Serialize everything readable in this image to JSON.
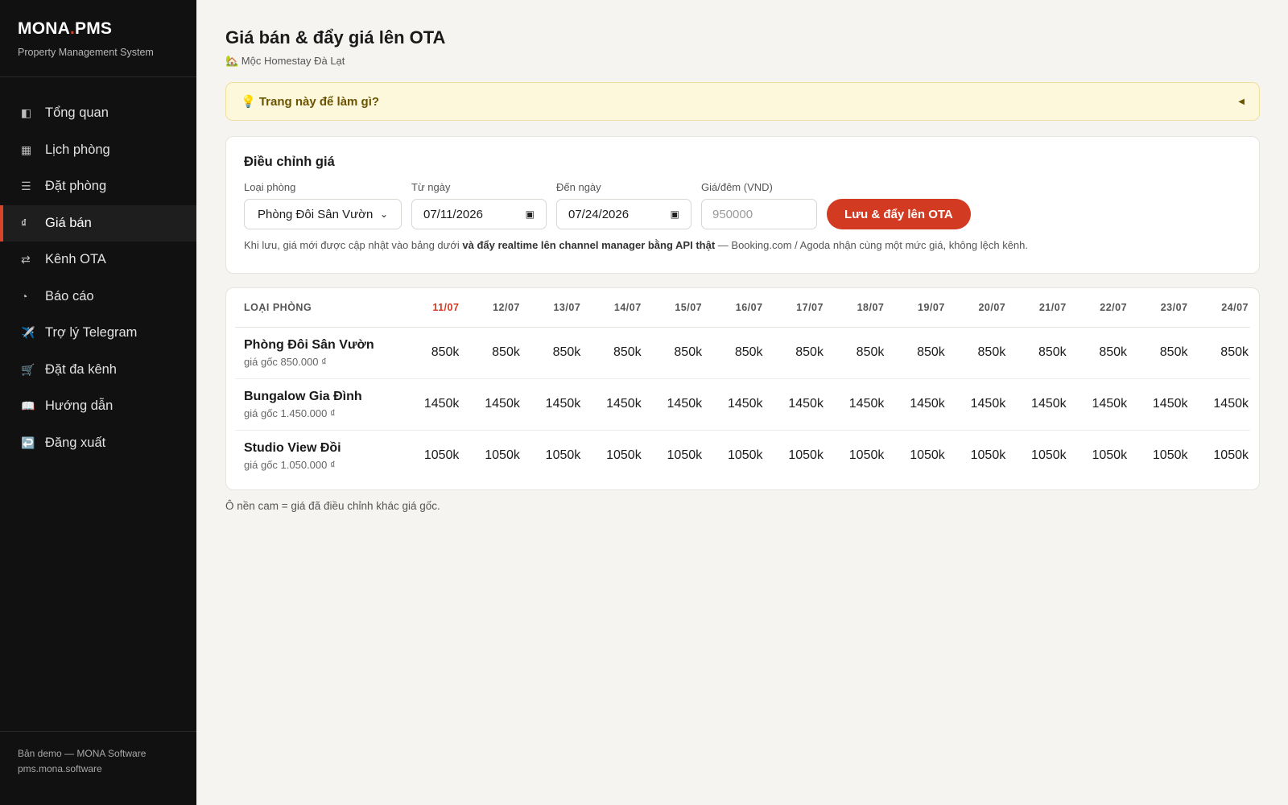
{
  "sidebar": {
    "brand_left": "MONA",
    "brand_dot": ".",
    "brand_right": "PMS",
    "subtitle": "Property Management System",
    "items": [
      {
        "icon": "◧",
        "label": "Tổng quan"
      },
      {
        "icon": "▦",
        "label": "Lịch phòng"
      },
      {
        "icon": "☰",
        "label": "Đặt phòng"
      },
      {
        "icon": "₫",
        "label": "Giá bán"
      },
      {
        "icon": "⇄",
        "label": "Kênh OTA"
      },
      {
        "icon": "◔",
        "label": "Báo cáo"
      },
      {
        "icon": "✈️",
        "label": "Trợ lý Telegram"
      },
      {
        "icon": "🛒",
        "label": "Đặt đa kênh"
      },
      {
        "icon": "📖",
        "label": "Hướng dẫn"
      },
      {
        "icon": "↩️",
        "label": "Đăng xuất"
      }
    ],
    "active_index": 3,
    "footer_line1": "Bản demo — MONA Software",
    "footer_line2": "pms.mona.software"
  },
  "header": {
    "title": "Giá bán & đẩy giá lên OTA",
    "property": "🏡 Mộc Homestay Đà Lạt"
  },
  "hint": {
    "label": "💡 Trang này để làm gì?",
    "caret": "◀"
  },
  "adjust": {
    "title": "Điều chỉnh giá",
    "room_type_label": "Loại phòng",
    "room_type_value": "Phòng Đôi Sân Vườn",
    "from_label": "Từ ngày",
    "from_value": "07/11/2026",
    "to_label": "Đến ngày",
    "to_value": "07/24/2026",
    "price_label": "Giá/đêm (VND)",
    "price_placeholder": "950000",
    "submit_label": "Lưu & đẩy lên OTA",
    "note_before": "Khi lưu, giá mới được cập nhật vào bảng dưới ",
    "note_bold": "và đẩy realtime lên channel manager bằng API thật",
    "note_after": " — Booking.com / Agoda nhận cùng một mức giá, không lệch kênh."
  },
  "table": {
    "room_header": "LOẠI PHÒNG",
    "dates": [
      "11/07",
      "12/07",
      "13/07",
      "14/07",
      "15/07",
      "16/07",
      "17/07",
      "18/07",
      "19/07",
      "20/07",
      "21/07",
      "22/07",
      "23/07",
      "24/07"
    ],
    "today_index": 0,
    "rows": [
      {
        "name": "Phòng Đôi Sân Vườn",
        "base": "giá gốc 850.000 ₫",
        "prices": [
          "850k",
          "850k",
          "850k",
          "850k",
          "850k",
          "850k",
          "850k",
          "850k",
          "850k",
          "850k",
          "850k",
          "850k",
          "850k",
          "850k"
        ]
      },
      {
        "name": "Bungalow Gia Đình",
        "base": "giá gốc 1.450.000 ₫",
        "prices": [
          "1450k",
          "1450k",
          "1450k",
          "1450k",
          "1450k",
          "1450k",
          "1450k",
          "1450k",
          "1450k",
          "1450k",
          "1450k",
          "1450k",
          "1450k",
          "1450k"
        ]
      },
      {
        "name": "Studio View Đồi",
        "base": "giá gốc 1.050.000 ₫",
        "prices": [
          "1050k",
          "1050k",
          "1050k",
          "1050k",
          "1050k",
          "1050k",
          "1050k",
          "1050k",
          "1050k",
          "1050k",
          "1050k",
          "1050k",
          "1050k",
          "1050k"
        ]
      }
    ]
  },
  "legend_note": "Ô nền cam = giá đã điều chỉnh khác giá gốc.",
  "colors": {
    "accent": "#d33a22",
    "sidebar_bg": "#111111",
    "hint_bg": "#fdf7dc"
  }
}
